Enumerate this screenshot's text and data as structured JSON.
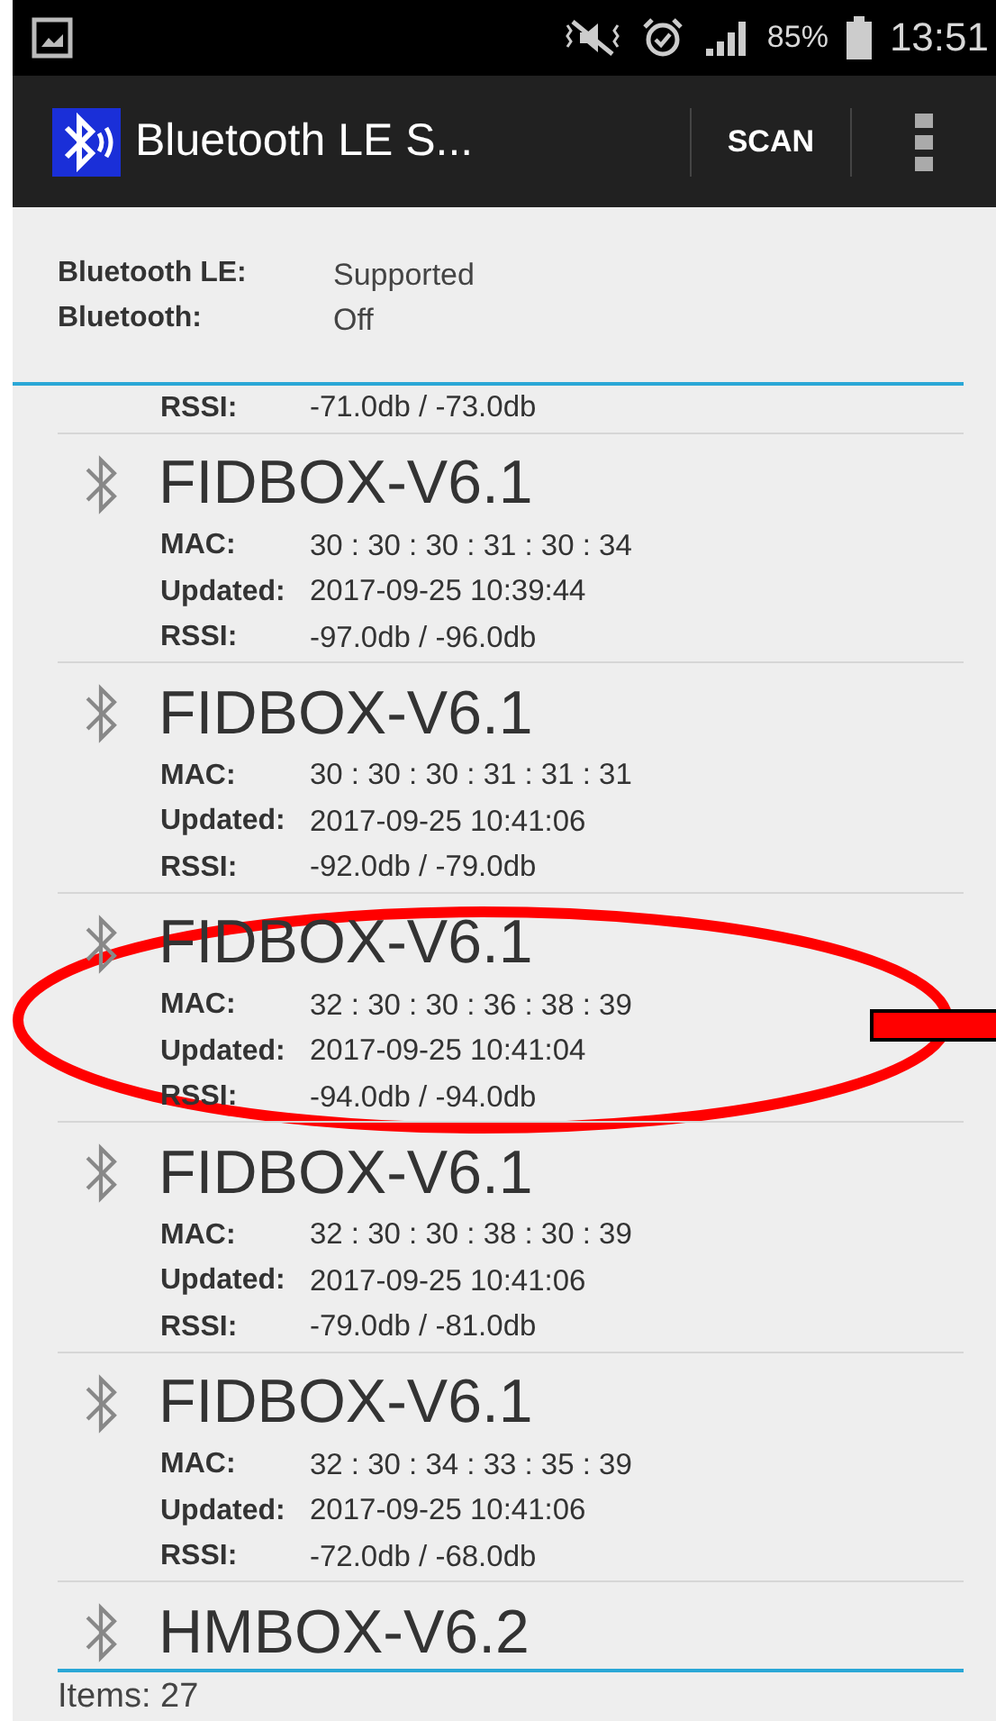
{
  "status_bar": {
    "battery": "85%",
    "time": "13:51"
  },
  "app_bar": {
    "title": "Bluetooth LE S...",
    "action": "SCAN"
  },
  "info": [
    {
      "label": "Bluetooth LE:",
      "value": "Supported"
    },
    {
      "label": "Bluetooth:",
      "value": "Off"
    }
  ],
  "devices": [
    {
      "fields": [
        {
          "label": "RSSI:",
          "value": "-71.0db / -73.0db"
        }
      ]
    },
    {
      "name": "FIDBOX-V6.1",
      "fields": [
        {
          "label": "MAC:",
          "value": "30 : 30 : 30 : 31 : 30 : 34"
        },
        {
          "label": "Updated:",
          "value": "2017-09-25 10:39:44"
        },
        {
          "label": "RSSI:",
          "value": "-97.0db / -96.0db"
        }
      ]
    },
    {
      "name": "FIDBOX-V6.1",
      "fields": [
        {
          "label": "MAC:",
          "value": "30 : 30 : 30 : 31 : 31 : 31"
        },
        {
          "label": "Updated:",
          "value": "2017-09-25 10:41:06"
        },
        {
          "label": "RSSI:",
          "value": "-92.0db / -79.0db"
        }
      ]
    },
    {
      "name": "FIDBOX-V6.1",
      "fields": [
        {
          "label": "MAC:",
          "value": "32 : 30 : 30 : 36 : 38 : 39"
        },
        {
          "label": "Updated:",
          "value": "2017-09-25 10:41:04"
        },
        {
          "label": "RSSI:",
          "value": "-94.0db / -94.0db"
        }
      ]
    },
    {
      "name": "FIDBOX-V6.1",
      "fields": [
        {
          "label": "MAC:",
          "value": "32 : 30 : 30 : 38 : 30 : 39"
        },
        {
          "label": "Updated:",
          "value": "2017-09-25 10:41:06"
        },
        {
          "label": "RSSI:",
          "value": "-79.0db / -81.0db"
        }
      ]
    },
    {
      "name": "FIDBOX-V6.1",
      "fields": [
        {
          "label": "MAC:",
          "value": "32 : 30 : 34 : 33 : 35 : 39"
        },
        {
          "label": "Updated:",
          "value": "2017-09-25 10:41:06"
        },
        {
          "label": "RSSI:",
          "value": "-72.0db / -68.0db"
        }
      ]
    },
    {
      "name": "HMBOX-V6.2"
    }
  ],
  "footer": {
    "count": "Items: 27"
  }
}
